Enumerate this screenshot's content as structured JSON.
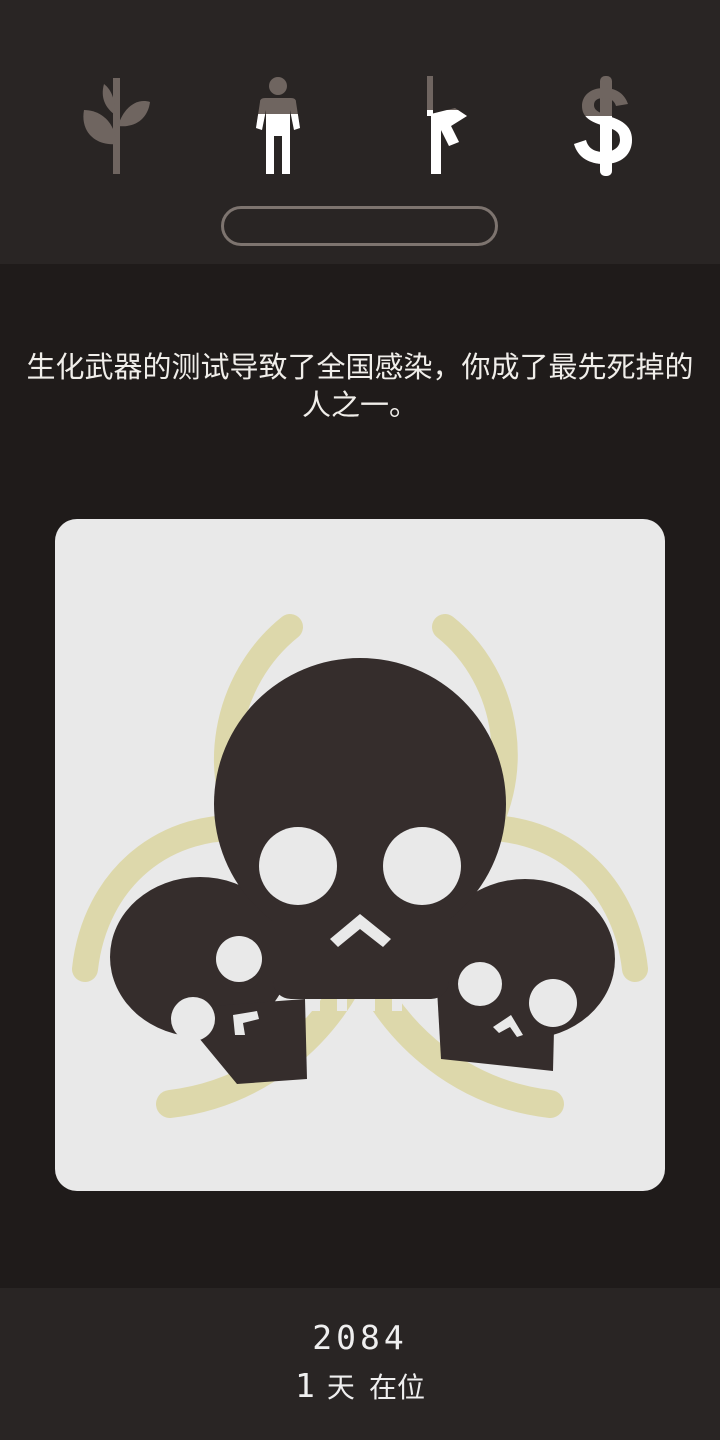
{
  "stats": [
    {
      "name": "nature",
      "icon": "plant-icon",
      "level": 0
    },
    {
      "name": "people",
      "icon": "person-icon",
      "level": 0.62
    },
    {
      "name": "military",
      "icon": "rifle-icon",
      "level": 0.58
    },
    {
      "name": "money",
      "icon": "dollar-icon",
      "level": 0.55
    }
  ],
  "progress": {
    "value": 0
  },
  "event": {
    "text": "生化武器的测试导致了全国感染，你成了最先死掉的人之一。",
    "image": "biohazard-skulls-icon"
  },
  "footer": {
    "year": "2084",
    "days": "1",
    "days_unit": "天",
    "status": "在位"
  },
  "colors": {
    "background": "#1f1b1a",
    "bar": "#292524",
    "icon_empty": "#6f6560",
    "icon_full": "#ffffff",
    "card": "#e9e9e9",
    "skull": "#352d2c",
    "biohazard": "#ddd8ab"
  }
}
